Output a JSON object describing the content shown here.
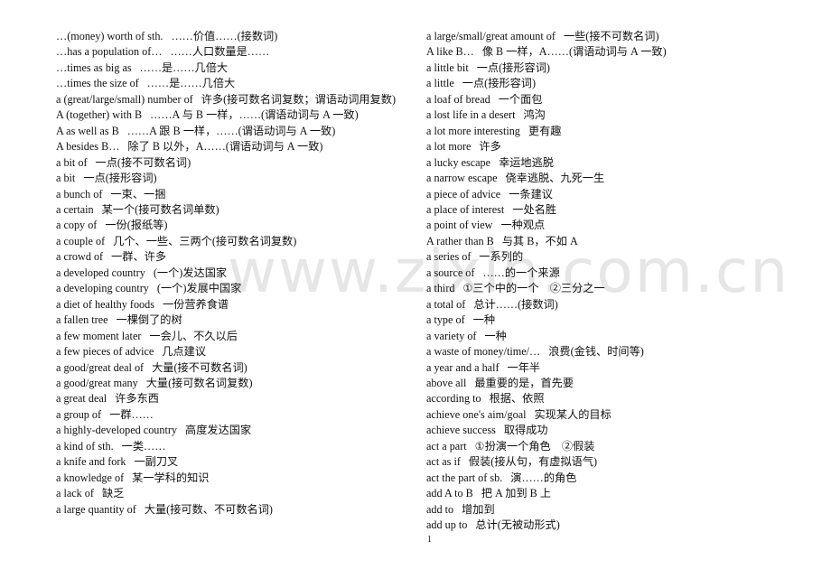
{
  "watermark": "www.zixin.com.cn",
  "page_number": "1",
  "left_column": [
    {
      "en": "…(money) worth of sth.",
      "zh": "……价值……(接数词)"
    },
    {
      "en": "…has a population of…",
      "zh": "……人口数量是……"
    },
    {
      "en": "…times as big as",
      "zh": "……是……几倍大"
    },
    {
      "en": "…times the size of",
      "zh": "……是……几倍大"
    },
    {
      "en": "a (great/large/small) number of",
      "zh": "许多(接可数名词复数；谓语动词用复数)"
    },
    {
      "en": "A (together) with B",
      "zh": "……A 与 B 一样，……(谓语动词与 A 一致)"
    },
    {
      "en": "A as well as B",
      "zh": "……A 跟 B 一样，……(谓语动词与 A 一致)"
    },
    {
      "en": "A besides B…",
      "zh": "除了 B 以外，A……(谓语动词与 A 一致)"
    },
    {
      "en": "a bit of",
      "zh": "一点(接不可数名词)"
    },
    {
      "en": "a bit",
      "zh": "一点(接形容词)"
    },
    {
      "en": "a bunch of",
      "zh": "一束、一捆"
    },
    {
      "en": "a certain",
      "zh": "某一个(接可数名词单数)"
    },
    {
      "en": "a copy of",
      "zh": "一份(报纸等)"
    },
    {
      "en": "a couple of",
      "zh": "几个、一些、三两个(接可数名词复数)"
    },
    {
      "en": "a crowd of",
      "zh": "一群、许多"
    },
    {
      "en": "a developed country",
      "zh": "(一个)发达国家"
    },
    {
      "en": "a developing country",
      "zh": "(一个)发展中国家"
    },
    {
      "en": "a diet of healthy foods",
      "zh": "一份营养食谱"
    },
    {
      "en": "a fallen tree",
      "zh": "一棵倒了的树"
    },
    {
      "en": "a few moment later",
      "zh": "一会儿、不久以后"
    },
    {
      "en": "a few pieces of advice",
      "zh": "几点建议"
    },
    {
      "en": "a good/great deal of",
      "zh": "大量(接不可数名词)"
    },
    {
      "en": "a good/great many",
      "zh": "大量(接可数名词复数)"
    },
    {
      "en": "a great deal",
      "zh": "许多东西"
    },
    {
      "en": "a group of",
      "zh": "一群……"
    },
    {
      "en": "a highly-developed country",
      "zh": "高度发达国家"
    },
    {
      "en": "a kind of sth.",
      "zh": "一类……"
    },
    {
      "en": "a knife and fork",
      "zh": "一副刀叉"
    },
    {
      "en": "a knowledge of",
      "zh": "某一学科的知识"
    },
    {
      "en": "a lack of",
      "zh": "缺乏"
    },
    {
      "en": "a large quantity of",
      "zh": "大量(接可数、不可数名词)"
    }
  ],
  "right_column": [
    {
      "en": "a large/small/great amount of",
      "zh": "一些(接不可数名词)"
    },
    {
      "en": "A like B…",
      "zh": "像 B 一样，A……(谓语动词与 A 一致)"
    },
    {
      "en": "a little bit",
      "zh": "一点(接形容词)"
    },
    {
      "en": "a little",
      "zh": "一点(接形容词)"
    },
    {
      "en": "a loaf of bread",
      "zh": "一个面包"
    },
    {
      "en": "a lost life in a desert",
      "zh": "鸿沟"
    },
    {
      "en": "a lot more interesting",
      "zh": "更有趣"
    },
    {
      "en": "a lot more",
      "zh": "许多"
    },
    {
      "en": "a lucky escape",
      "zh": "幸运地逃脱"
    },
    {
      "en": "a narrow escape",
      "zh": "侥幸逃脱、九死一生"
    },
    {
      "en": "a piece of advice",
      "zh": "一条建议"
    },
    {
      "en": "a place of interest",
      "zh": "一处名胜"
    },
    {
      "en": "a point of view",
      "zh": "一种观点"
    },
    {
      "en": "A rather than B",
      "zh": "与其 B，不如 A"
    },
    {
      "en": "a series of",
      "zh": "一系列的"
    },
    {
      "en": "a source of",
      "zh": "……的一个来源"
    },
    {
      "en": "a third",
      "zh": "①三个中的一个　②三分之一"
    },
    {
      "en": "a total of",
      "zh": "总计……(接数词)"
    },
    {
      "en": "a type of",
      "zh": "一种"
    },
    {
      "en": "a variety of",
      "zh": "一种"
    },
    {
      "en": "a waste of money/time/…",
      "zh": "浪费(金钱、时间等)"
    },
    {
      "en": "a year and a half",
      "zh": "一年半"
    },
    {
      "en": "above all",
      "zh": "最重要的是，首先要"
    },
    {
      "en": "according to",
      "zh": "根据、依照"
    },
    {
      "en": "achieve one's aim/goal",
      "zh": "实现某人的目标"
    },
    {
      "en": "achieve success",
      "zh": "取得成功"
    },
    {
      "en": "act a part",
      "zh": "①扮演一个角色　②假装"
    },
    {
      "en": "act as if",
      "zh": "假装(接从句，有虚拟语气)"
    },
    {
      "en": "act the part of sb.",
      "zh": "演……的角色"
    },
    {
      "en": "add A to B",
      "zh": "把 A 加到 B 上"
    },
    {
      "en": "add to",
      "zh": "增加到"
    },
    {
      "en": "add up to",
      "zh": "总计(无被动形式)"
    }
  ]
}
